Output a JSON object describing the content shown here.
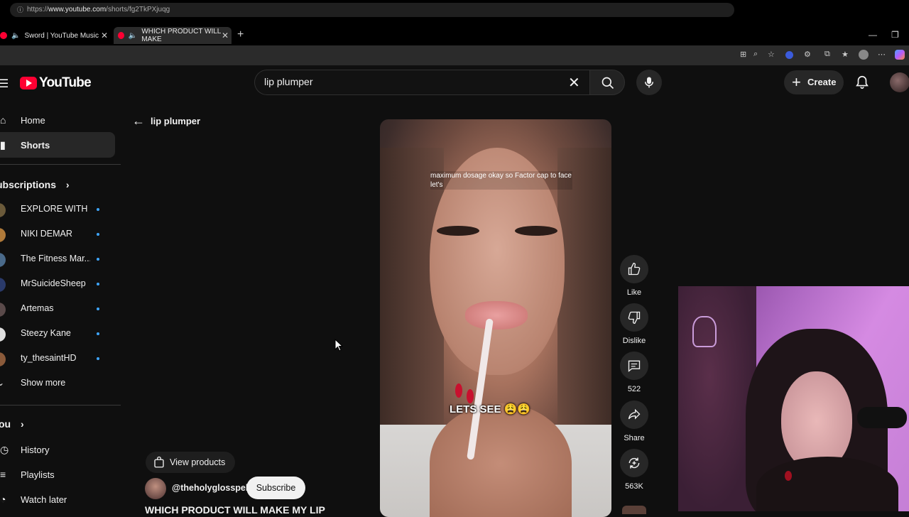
{
  "browser": {
    "tabs": [
      {
        "title": "Sword | YouTube Music",
        "active": false
      },
      {
        "title": "WHICH PRODUCT WILL MAKE",
        "active": true
      }
    ],
    "url_prefix": "https://",
    "url_host": "www.youtube.com",
    "url_path": "/shorts/fg2TkPXjuqg"
  },
  "header": {
    "logo": "YouTube",
    "search_value": "lip plumper",
    "create_label": "Create"
  },
  "sidebar": {
    "items": [
      {
        "label": "Home",
        "icon": "home-icon"
      },
      {
        "label": "Shorts",
        "icon": "shorts-icon"
      }
    ],
    "subscriptions_heading": "ubscriptions",
    "subscriptions": [
      {
        "name": "EXPLORE WITH ...",
        "color": "#6b5a3a"
      },
      {
        "name": "NIKI DEMAR",
        "color": "#b07a3a"
      },
      {
        "name": "The Fitness Mar...",
        "color": "#4a6a8a"
      },
      {
        "name": "MrSuicideSheep",
        "color": "#2a3a6a"
      },
      {
        "name": "Artemas",
        "color": "#5a4a4a"
      },
      {
        "name": "Steezy Kane",
        "color": "#e0e0e0"
      },
      {
        "name": "ty_thesaintHD",
        "color": "#8a5a3a"
      }
    ],
    "show_more": "Show more",
    "you_heading": "ou",
    "you_items": [
      {
        "label": "History",
        "icon": "history-icon"
      },
      {
        "label": "Playlists",
        "icon": "playlists-icon"
      },
      {
        "label": "Watch later",
        "icon": "watch-later-icon"
      }
    ]
  },
  "main": {
    "back_label": "lip plumper",
    "caption_top": "maximum dosage okay so Factor cap to face let's",
    "caption_bottom": "LETS SEE 😩😩",
    "actions": {
      "like": "Like",
      "dislike": "Dislike",
      "comments": "522",
      "share": "Share",
      "remix": "563K"
    },
    "view_products": "View products",
    "channel_handle": "@theholyglosspel",
    "subscribe": "Subscribe",
    "title": "WHICH PRODUCT WILL MAKE MY LIP"
  },
  "colors": {
    "accent_red": "#ff0033",
    "new_dot": "#3ea6ff",
    "background": "#0f0f0f"
  }
}
